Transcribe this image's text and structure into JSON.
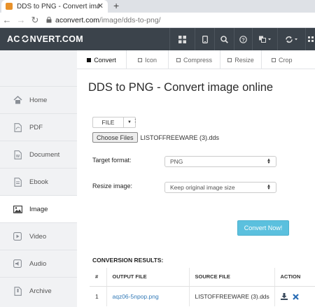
{
  "browser": {
    "tab_title": "DDS to PNG - Convert image onli",
    "tab_close": "✕",
    "new_tab": "+",
    "url_domain": "aconvert.com",
    "url_path": "/image/dds-to-png/"
  },
  "site": {
    "logo_left": "AC",
    "logo_right": "NVERT.COM",
    "header_icons": [
      "grid-icon",
      "mobile-icon",
      "search-icon",
      "help-icon",
      "language-icon",
      "refresh-icon",
      "menu-icon"
    ]
  },
  "sidebar": {
    "items": [
      {
        "label": "Home",
        "icon": "home-icon"
      },
      {
        "label": "PDF",
        "icon": "pdf-icon"
      },
      {
        "label": "Document",
        "icon": "document-icon"
      },
      {
        "label": "Ebook",
        "icon": "ebook-icon"
      },
      {
        "label": "Image",
        "icon": "image-icon"
      },
      {
        "label": "Video",
        "icon": "video-icon"
      },
      {
        "label": "Audio",
        "icon": "audio-icon"
      },
      {
        "label": "Archive",
        "icon": "archive-icon"
      }
    ]
  },
  "subtabs": [
    {
      "label": "Convert"
    },
    {
      "label": "Icon"
    },
    {
      "label": "Compress"
    },
    {
      "label": "Resize"
    },
    {
      "label": "Crop"
    }
  ],
  "main": {
    "title": "DDS to PNG - Convert image online",
    "file_button": "FILE",
    "file_colon": ":",
    "choose_button": "Choose Files",
    "chosen_file": "LISTOFFREEWARE (3).dds",
    "target_label": "Target format:",
    "target_value": "PNG",
    "resize_label": "Resize image:",
    "resize_value": "Keep original image size",
    "convert_button": "Convert Now!",
    "results_heading": "CONVERSION RESULTS:"
  },
  "results": {
    "columns": [
      "#",
      "OUTPUT FILE",
      "SOURCE FILE",
      "ACTION"
    ],
    "rows": [
      {
        "num": "1",
        "output": "aqz06-5npop.png",
        "source": "LISTOFFREEWARE (3).dds"
      }
    ]
  },
  "colors": {
    "header_bg": "#3b434b",
    "convert_btn": "#5bc0de",
    "link": "#337ab7"
  }
}
